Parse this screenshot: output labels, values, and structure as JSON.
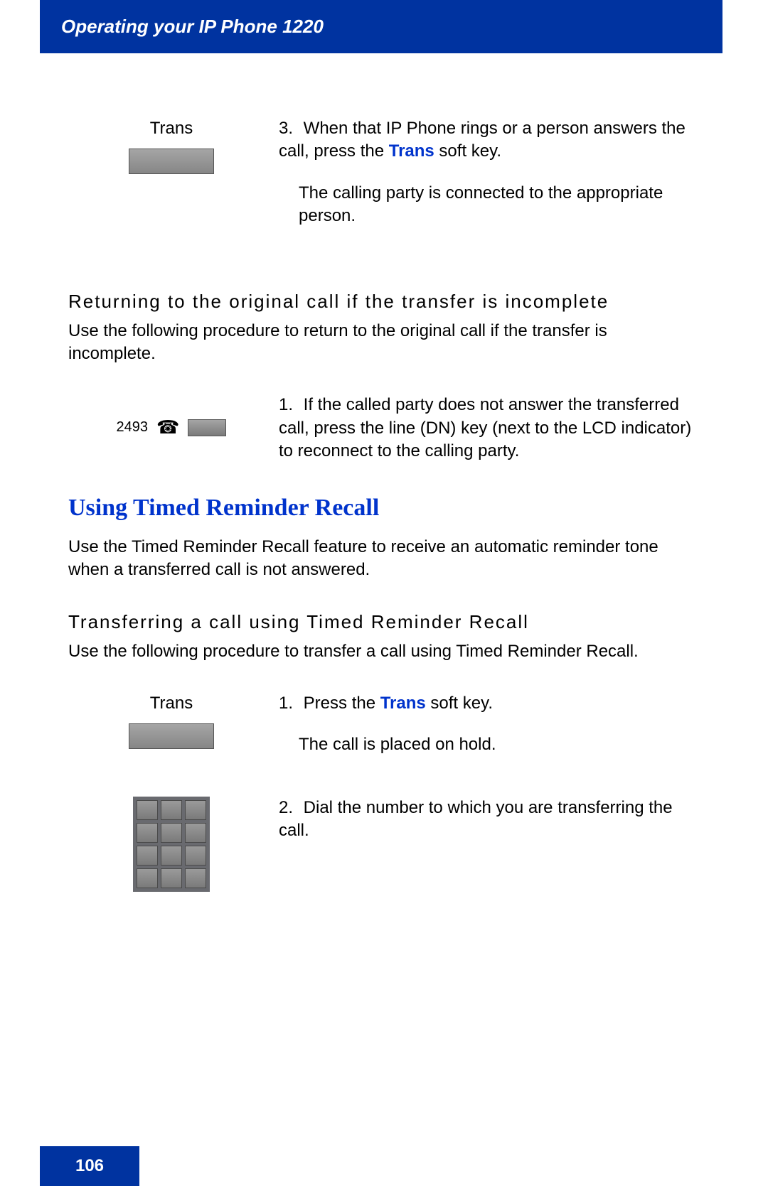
{
  "header": {
    "title": "Operating your IP Phone 1220"
  },
  "step3": {
    "left_label": "Trans",
    "num": "3.",
    "text_a_pre": "When that IP Phone rings or a person answers the call, press the ",
    "text_a_em": "Trans",
    "text_a_post": " soft key.",
    "text_b": "The calling party is connected to the appropriate person."
  },
  "sub1": {
    "heading": "Returning to the original call if the transfer is incomplete",
    "body": "Use the following procedure to return to the original call if the transfer is incomplete."
  },
  "line_step": {
    "ext": "2493",
    "num": "1.",
    "text": "If the called party does not answer the transferred call, press the line (DN) key (next to the LCD indicator) to reconnect to the calling party."
  },
  "section": {
    "heading": "Using Timed Reminder Recall",
    "body": "Use the Timed Reminder Recall feature to receive an automatic reminder tone when a transferred call is not answered."
  },
  "sub2": {
    "heading": "Transferring a call using Timed Reminder Recall",
    "body": "Use the following procedure to transfer a call using Timed Reminder Recall."
  },
  "tr_step1": {
    "left_label": "Trans",
    "num": "1.",
    "text_pre": "Press the ",
    "text_em": "Trans",
    "text_post": " soft key.",
    "text_b": "The call is placed on hold."
  },
  "tr_step2": {
    "num": "2.",
    "text": "Dial the number to which you are transferring the call."
  },
  "footer": {
    "page": "106"
  }
}
